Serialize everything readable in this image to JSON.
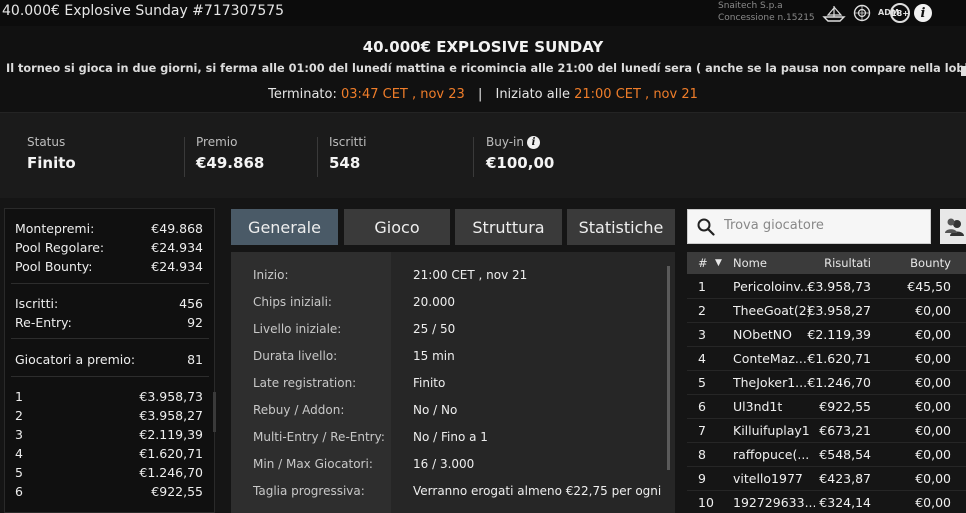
{
  "window": {
    "title": "40.000€ Explosive Sunday #717307575"
  },
  "brand": {
    "line1": "Snaitech S.p.a",
    "line2": "Concessione n.15215",
    "age_badge": "18+",
    "adm": "ADM",
    "info_icon": "info-icon"
  },
  "header": {
    "title": "40.000€ EXPLOSIVE SUNDAY",
    "description": "Il torneo si gioca in due giorni, si ferma alle 01:00 del lunedí mattina e ricomincia alle 21:00 del lunedí sera ( anche se la pausa non compare nella lobby)....",
    "ended_label": "Terminato:",
    "ended_value": "03:47 CET , nov 23",
    "separator": "|",
    "started_label": "Iniziato alle",
    "started_value": "21:00 CET , nov 21"
  },
  "stats": {
    "status_label": "Status",
    "status_value": "Finito",
    "prize_label": "Premio",
    "prize_value": "€49.868",
    "entries_label": "Iscritti",
    "entries_value": "548",
    "buyin_label": "Buy-in",
    "buyin_value": "€100,00"
  },
  "prizepool": {
    "montepremi_label": "Montepremi:",
    "montepremi_value": "€49.868",
    "regular_label": "Pool Regolare:",
    "regular_value": "€24.934",
    "bounty_label": "Pool Bounty:",
    "bounty_value": "€24.934",
    "iscritti_label": "Iscritti:",
    "iscritti_value": "456",
    "reentry_label": "Re-Entry:",
    "reentry_value": "92",
    "paid_label": "Giocatori a premio:",
    "paid_value": "81",
    "payouts": [
      {
        "pos": "1",
        "amount": "€3.958,73"
      },
      {
        "pos": "2",
        "amount": "€3.958,27"
      },
      {
        "pos": "3",
        "amount": "€2.119,39"
      },
      {
        "pos": "4",
        "amount": "€1.620,71"
      },
      {
        "pos": "5",
        "amount": "€1.246,70"
      },
      {
        "pos": "6",
        "amount": "€922,55"
      }
    ]
  },
  "tabs": [
    {
      "label": "Generale",
      "active": true
    },
    {
      "label": "Gioco",
      "active": false
    },
    {
      "label": "Struttura",
      "active": false
    },
    {
      "label": "Statistiche",
      "active": false
    }
  ],
  "details": [
    {
      "label": "Inizio:",
      "value": "21:00 CET , nov 21"
    },
    {
      "label": "Chips iniziali:",
      "value": "20.000"
    },
    {
      "label": "Livello iniziale:",
      "value": "25 / 50"
    },
    {
      "label": "Durata livello:",
      "value": "15 min"
    },
    {
      "label": "Late registration:",
      "value": "Finito"
    },
    {
      "label": "Rebuy / Addon:",
      "value": "No / No"
    },
    {
      "label": "Multi-Entry / Re-Entry:",
      "value": "No / Fino a 1"
    },
    {
      "label": "Min / Max Giocatori:",
      "value": "16 / 3.000"
    },
    {
      "label": "Taglia progressiva:",
      "value": "Verranno erogati almeno €22,75 per ogni"
    }
  ],
  "search": {
    "placeholder": "Trova giocatore"
  },
  "results": {
    "headers": {
      "num": "#",
      "sort": "▼",
      "name": "Nome",
      "result": "Risultati",
      "bounty": "Bounty"
    },
    "rows": [
      {
        "pos": "1",
        "name": "Pericoloinv...",
        "result": "€3.958,73",
        "bounty": "€45,50"
      },
      {
        "pos": "2",
        "name": "TheeGoat(2)",
        "result": "€3.958,27",
        "bounty": "€0,00"
      },
      {
        "pos": "3",
        "name": "NObetNO",
        "result": "€2.119,39",
        "bounty": "€0,00"
      },
      {
        "pos": "4",
        "name": "ConteMaz...",
        "result": "€1.620,71",
        "bounty": "€0,00"
      },
      {
        "pos": "5",
        "name": "TheJoker1...",
        "result": "€1.246,70",
        "bounty": "€0,00"
      },
      {
        "pos": "6",
        "name": "Ul3nd1t",
        "result": "€922,55",
        "bounty": "€0,00"
      },
      {
        "pos": "7",
        "name": "Killuifuplay1",
        "result": "€673,21",
        "bounty": "€0,00"
      },
      {
        "pos": "8",
        "name": "raffopuce(...",
        "result": "€548,54",
        "bounty": "€0,00"
      },
      {
        "pos": "9",
        "name": "vitello1977",
        "result": "€423,87",
        "bounty": "€0,00"
      },
      {
        "pos": "10",
        "name": "192729633...",
        "result": "€324,14",
        "bounty": "€0,00"
      }
    ]
  }
}
